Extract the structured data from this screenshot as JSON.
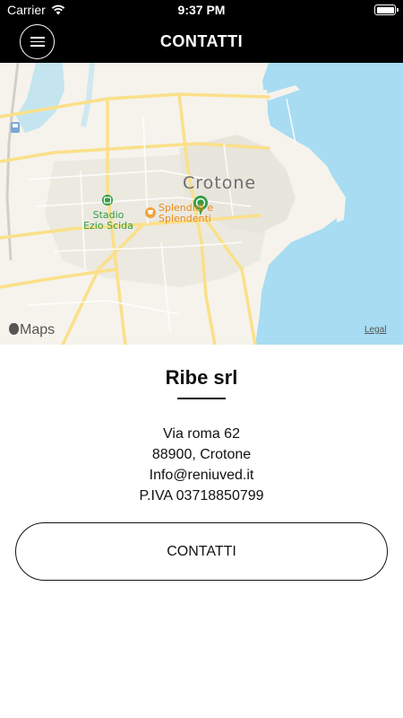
{
  "status_bar": {
    "carrier": "Carrier",
    "time": "9:37 PM",
    "battery_level": 1.0
  },
  "header": {
    "title": "CONTATTI",
    "menu_icon": "hamburger-menu-icon"
  },
  "map": {
    "city": "Crotone",
    "poi_stadium_line1": "Stadio",
    "poi_stadium_line2": "Ezio Scida",
    "poi_shop_line1": "Splendidi e",
    "poi_shop_line2": "Splendenti",
    "provider": "Maps",
    "legal": "Legal",
    "colors": {
      "land": "#f5f3ec",
      "water": "#a7dcf2",
      "road": "#fbe089",
      "pin": "#2f9e44"
    }
  },
  "company": {
    "name": "Ribe srl",
    "street": "Via roma 62",
    "city": "88900, Crotone",
    "email": "Info@reniuved.it",
    "vat": "P.IVA 03718850799"
  },
  "actions": {
    "contact_label": "CONTATTI"
  }
}
